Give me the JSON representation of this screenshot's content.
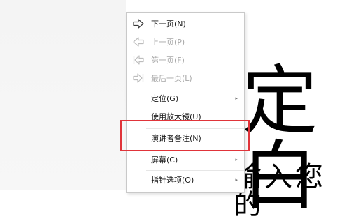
{
  "slide": {
    "big_glyph": "定白",
    "sub_text": "输入您的"
  },
  "menu": {
    "items": [
      {
        "label": "下一页(N)",
        "icon": "arrow-right-icon",
        "disabled": false
      },
      {
        "label": "上一页(P)",
        "icon": "arrow-left-icon",
        "disabled": true
      },
      {
        "label": "第一页(F)",
        "icon": "first-page-icon",
        "disabled": true
      },
      {
        "label": "最后一页(L)",
        "icon": "last-page-icon",
        "disabled": true
      },
      {
        "label": "定位(G)",
        "submenu": true
      },
      {
        "label": "使用放大镜(U)"
      },
      {
        "label": "演讲者备注(N)"
      },
      {
        "label": "屏幕(C)",
        "submenu": true
      },
      {
        "label": "指针选项(O)",
        "submenu": true
      }
    ]
  },
  "colors": {
    "highlight": "#e0343a",
    "disabled_text": "#a8a8a8",
    "text": "#1a1a1a"
  }
}
